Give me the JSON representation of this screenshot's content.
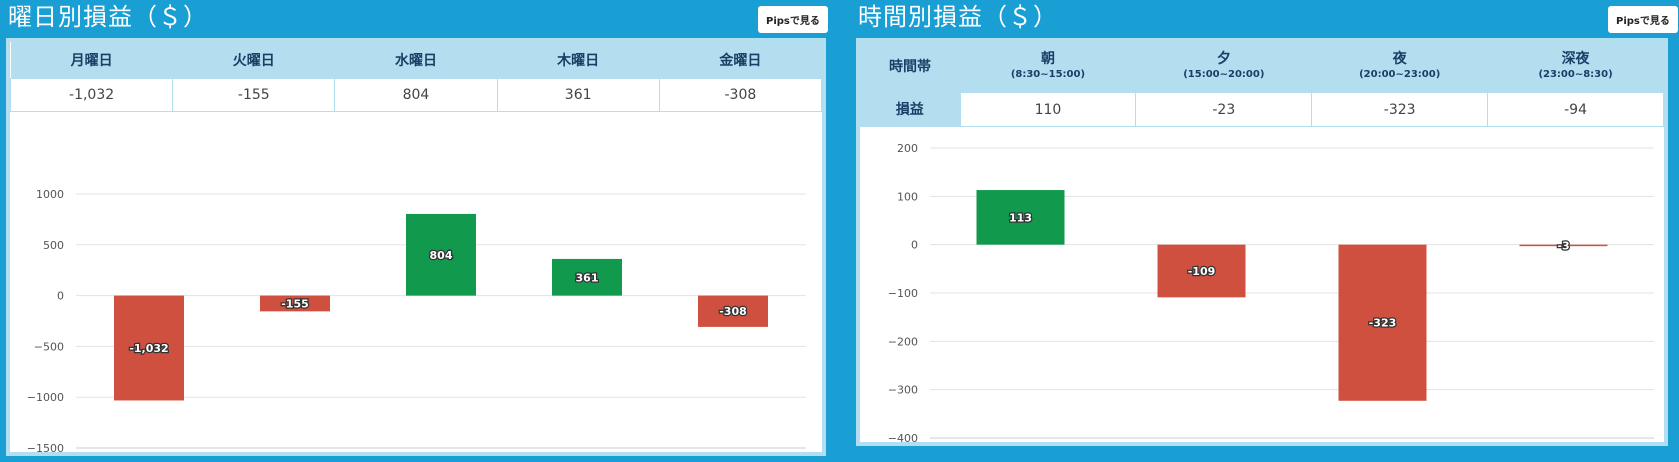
{
  "colors": {
    "positive": "#119a4e",
    "negative": "#d05040",
    "grid": "#e3e3e3",
    "background": "#1a9fd4"
  },
  "weekday": {
    "title": "曜日別損益（＄）",
    "pips_button": "Pipsで見る",
    "headers": [
      "月曜日",
      "火曜日",
      "水曜日",
      "木曜日",
      "金曜日"
    ],
    "values": [
      "-1,032",
      "-155",
      "804",
      "361",
      "-308"
    ]
  },
  "timeband": {
    "title": "時間別損益（＄）",
    "pips_button": "Pipsで見る",
    "row_header": "時間帯",
    "value_header": "損益",
    "headers": [
      {
        "name": "朝",
        "range": "(8:30~15:00)"
      },
      {
        "name": "夕",
        "range": "(15:00~20:00)"
      },
      {
        "name": "夜",
        "range": "(20:00~23:00)"
      },
      {
        "name": "深夜",
        "range": "(23:00~8:30)"
      }
    ],
    "values": [
      "110",
      "-23",
      "-323",
      "-94"
    ]
  },
  "chart_data": [
    {
      "type": "bar",
      "categories": [
        "月",
        "火",
        "水",
        "木",
        "金"
      ],
      "values": [
        -1032,
        -155,
        804,
        361,
        -308
      ],
      "data_labels": [
        "-1,032",
        "-155",
        "804",
        "361",
        "-308"
      ],
      "ylim": [
        -1500,
        1000
      ],
      "yticks": [
        1000,
        500,
        0,
        -500,
        -1000,
        -1500
      ],
      "ytick_labels": [
        "1000",
        "500",
        "0",
        "−500",
        "−1000",
        "−1500"
      ],
      "grid": true
    },
    {
      "type": "bar",
      "categories": [
        "朝",
        "夕",
        "夜",
        "深夜"
      ],
      "values": [
        113,
        -109,
        -323,
        -3
      ],
      "data_labels": [
        "113",
        "-109",
        "-323",
        "-3"
      ],
      "ylim": [
        -400,
        200
      ],
      "yticks": [
        200,
        100,
        0,
        -100,
        -200,
        -300,
        -400
      ],
      "ytick_labels": [
        "200",
        "100",
        "0",
        "−100",
        "−200",
        "−300",
        "−400"
      ],
      "grid": true
    }
  ]
}
